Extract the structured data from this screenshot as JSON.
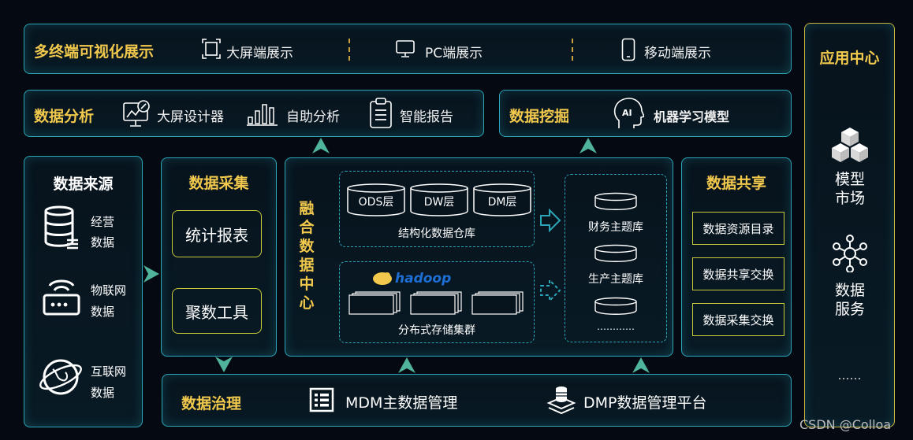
{
  "top": {
    "title": "多终端可视化展示",
    "items": [
      {
        "label": "大屏端展示",
        "icon": "fullscreen-icon"
      },
      {
        "label": "PC端展示",
        "icon": "monitor-icon"
      },
      {
        "label": "移动端展示",
        "icon": "mobile-icon"
      }
    ]
  },
  "analysis": {
    "title": "数据分析",
    "items": [
      {
        "label": "大屏设计器",
        "icon": "screen-design-icon"
      },
      {
        "label": "自助分析",
        "icon": "bar-chart-icon"
      },
      {
        "label": "智能报告",
        "icon": "clipboard-icon"
      }
    ]
  },
  "mining": {
    "title": "数据挖掘",
    "item": {
      "label": "机器学习模型",
      "icon": "ai-head-icon"
    }
  },
  "app_center": {
    "title": "应用中心",
    "items": [
      {
        "label": "模型市场",
        "icon": "cubes-icon"
      },
      {
        "label": "数据服务",
        "icon": "network-icon"
      }
    ],
    "more": "……"
  },
  "source": {
    "title": "数据来源",
    "items": [
      {
        "label": "经营数据",
        "icon": "database-icon"
      },
      {
        "label": "物联网数据",
        "icon": "router-icon"
      },
      {
        "label": "互联网数据",
        "icon": "globe-icon"
      }
    ]
  },
  "collect": {
    "title": "数据采集",
    "items": [
      "统计报表",
      "聚数工具"
    ]
  },
  "fusion": {
    "title": "融合数据中心",
    "structured": {
      "layers": [
        "ODS层",
        "DW层",
        "DM层"
      ],
      "label": "结构化数据仓库"
    },
    "distributed": {
      "logo": "hadoop",
      "label": "分布式存储集群"
    },
    "themes": [
      "财务主题库",
      "生产主题库",
      "…………"
    ]
  },
  "share": {
    "title": "数据共享",
    "items": [
      "数据资源目录",
      "数据共享交换",
      "数据采集交换"
    ]
  },
  "governance": {
    "title": "数据治理",
    "items": [
      {
        "label": "MDM主数据管理",
        "icon": "list-icon"
      },
      {
        "label": "DMP数据管理平台",
        "icon": "stack-icon"
      }
    ]
  },
  "watermark": "CSDN @Colloa",
  "colors": {
    "accent": "#2aa6b8",
    "gold": "#f2c94c",
    "background": "#050a12"
  }
}
